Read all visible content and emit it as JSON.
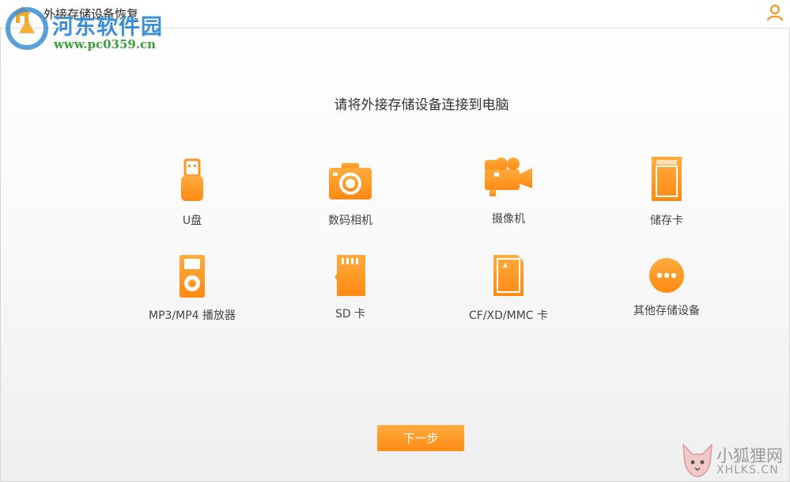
{
  "window": {
    "title": "外接存储设备恢复"
  },
  "watermark": {
    "site_name": "河东软件园",
    "site_url": "www.pc0359.cn",
    "corner_name": "小狐狸网",
    "corner_url": "XHLKS.CN"
  },
  "main": {
    "prompt": "请将外接存储设备连接到电脑",
    "devices": [
      {
        "label": "U盘",
        "icon": "usb-drive-icon"
      },
      {
        "label": "数码相机",
        "icon": "camera-icon"
      },
      {
        "label": "摄像机",
        "icon": "video-camera-icon"
      },
      {
        "label": "储存卡",
        "icon": "memory-card-icon"
      },
      {
        "label": "MP3/MP4 播放器",
        "icon": "mp3-player-icon"
      },
      {
        "label": "SD 卡",
        "icon": "sd-card-icon"
      },
      {
        "label": "CF/XD/MMC 卡",
        "icon": "cf-card-icon"
      },
      {
        "label": "其他存储设备",
        "icon": "more-icon"
      }
    ],
    "next_label": "下一步"
  },
  "colors": {
    "accent": "#ff8c14",
    "accent_light": "#ffab3d"
  }
}
